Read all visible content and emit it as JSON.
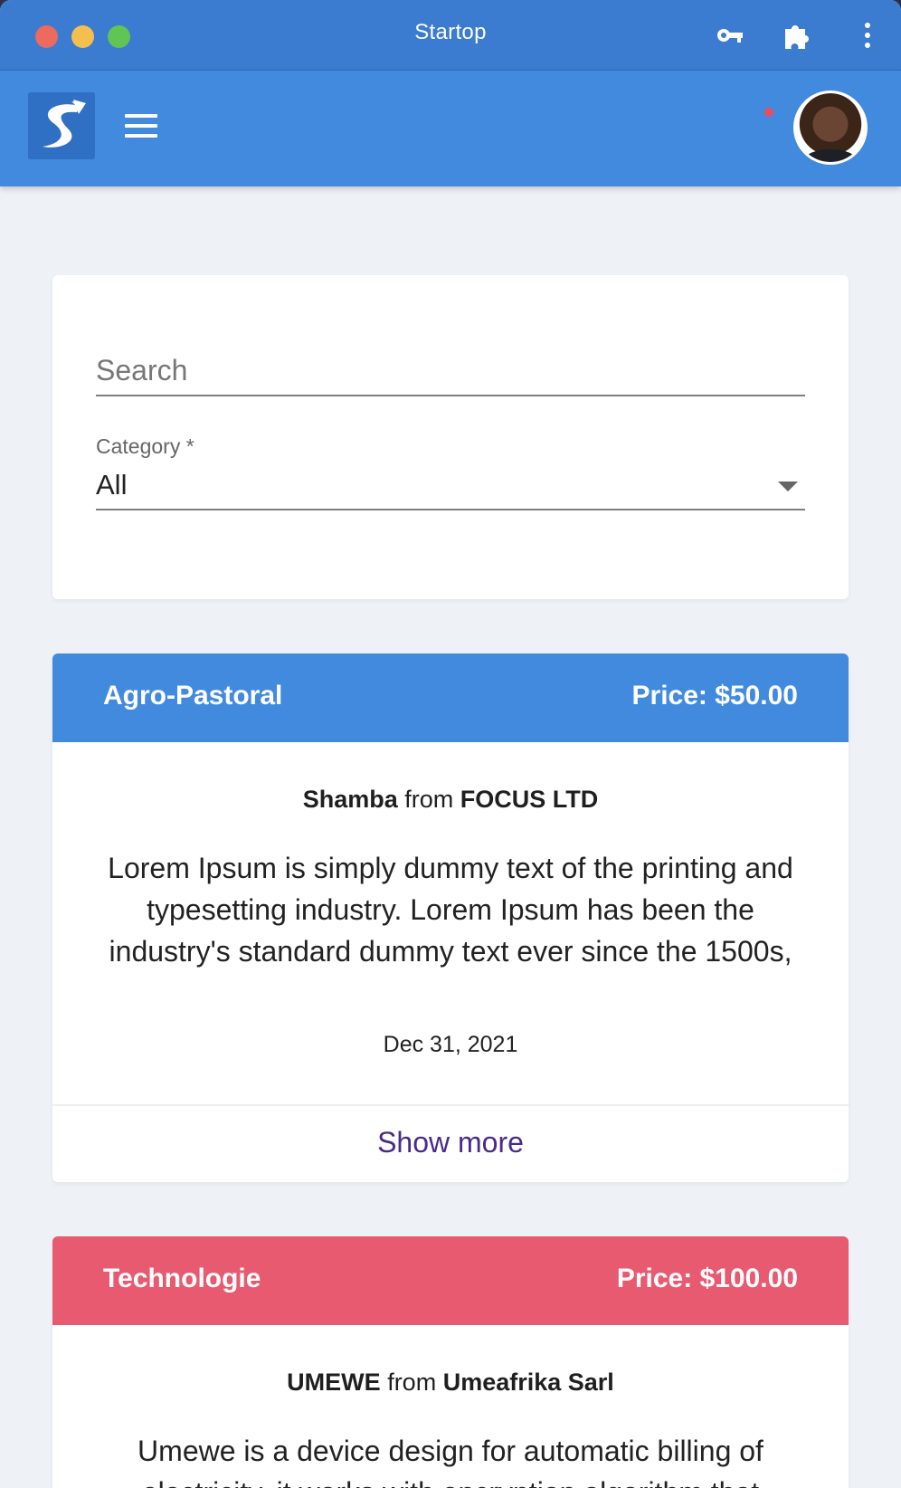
{
  "window": {
    "title": "Startop"
  },
  "filters": {
    "search_placeholder": "Search",
    "category_label": "Category *",
    "category_value": "All"
  },
  "projects": [
    {
      "category": "Agro-Pastoral",
      "price": "Price: $50.00",
      "header_color": "#428ade",
      "name": "Shamba",
      "connector": "from",
      "company": "FOCUS LTD",
      "description": "Lorem Ipsum is simply dummy text of the printing and typesetting industry. Lorem Ipsum has been the industry's standard dummy text ever since the 1500s,",
      "date": "Dec 31, 2021",
      "show_more": "Show more"
    },
    {
      "category": "Technologie",
      "price": "Price: $100.00",
      "header_color": "#e85a70",
      "name": "UMEWE",
      "connector": "from",
      "company": "Umeafrika Sarl",
      "description": "Umewe is a device design for automatic billing of electricity, it works with encryption algorithm that"
    }
  ],
  "icons": {
    "titlebar": [
      "key-icon",
      "puzzle-icon",
      "kebab-menu-icon"
    ],
    "appbar": [
      "logo",
      "hamburger-menu-icon",
      "notification-dot",
      "avatar"
    ]
  },
  "colors": {
    "titlebar": "#3b7bd0",
    "appbar": "#428ade",
    "background": "#eef2f7",
    "link": "#4a2a8a"
  }
}
